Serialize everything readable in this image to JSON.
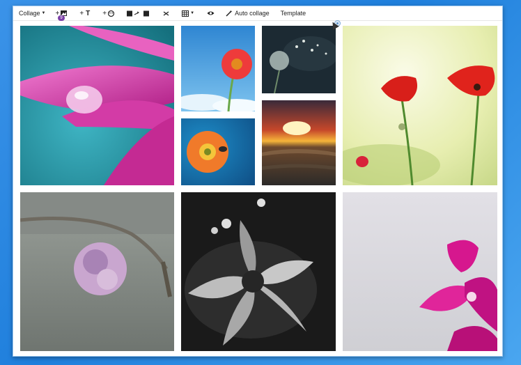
{
  "toolbar": {
    "collage_label": "Collage",
    "add_image_badge": "9",
    "auto_collage_label": "Auto collage",
    "template_label": "Template"
  },
  "icons": {
    "add_image": "image-plus-icon",
    "add_text": "text-plus-icon",
    "add_sticker": "sticker-plus-icon",
    "swap": "swap-images-icon",
    "shuffle": "shuffle-icon",
    "grid": "grid-layout-icon",
    "preview": "eye-icon",
    "magic": "magic-wand-icon"
  },
  "photos": [
    {
      "name": "pink-petal-droplet"
    },
    {
      "name": "red-daisy-sky"
    },
    {
      "name": "dandelion-dark"
    },
    {
      "name": "poppies-field"
    },
    {
      "name": "orange-flower-blue"
    },
    {
      "name": "sunset-sea"
    },
    {
      "name": "pink-rose-gray"
    },
    {
      "name": "bw-flower"
    },
    {
      "name": "magenta-orchid"
    }
  ]
}
